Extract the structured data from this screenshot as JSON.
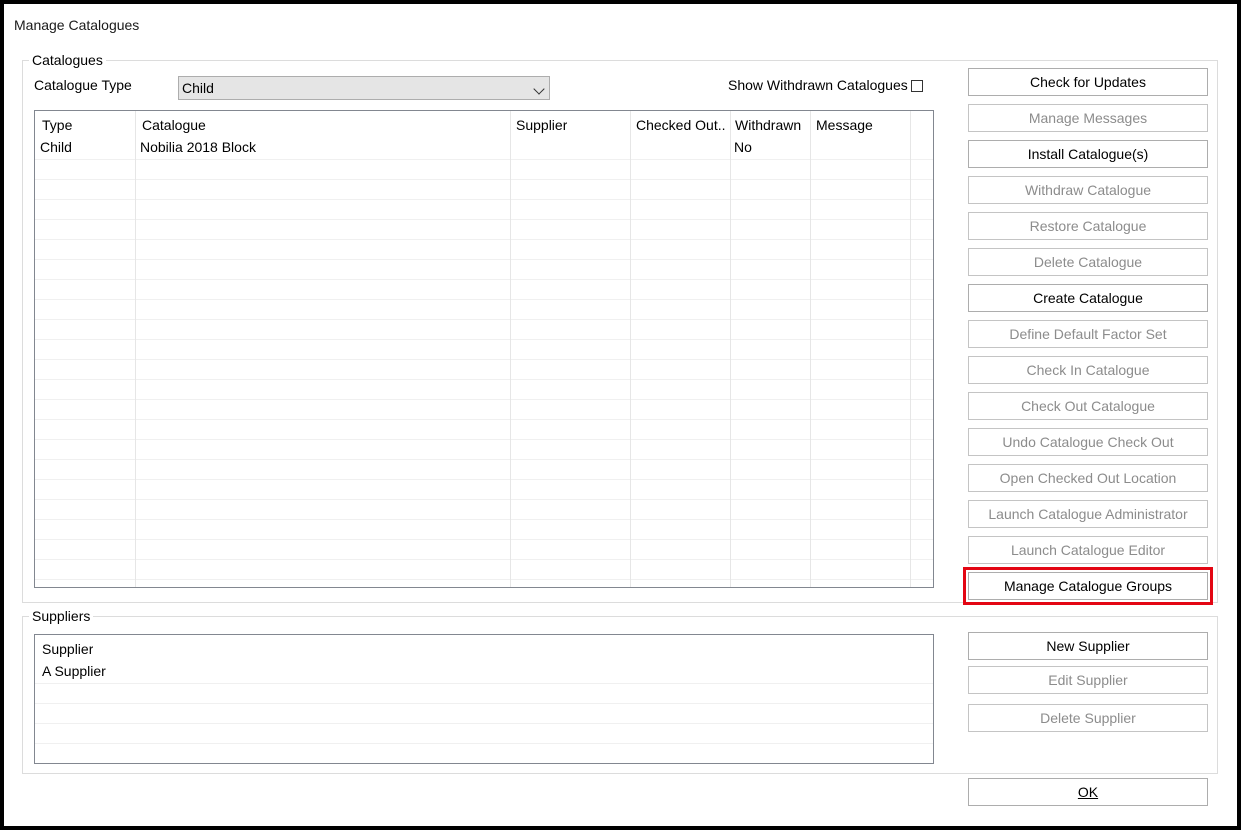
{
  "window": {
    "title": "Manage Catalogues"
  },
  "catalogues_group": {
    "legend": "Catalogues",
    "type_label": "Catalogue Type",
    "type_value": "Child",
    "show_withdrawn_label": "Show Withdrawn Catalogues",
    "show_withdrawn_checked": false,
    "table": {
      "columns": [
        "Type",
        "Catalogue",
        "Supplier",
        "Checked Out...",
        "Withdrawn",
        "Message"
      ],
      "rows": [
        {
          "type": "Child",
          "catalogue": "Nobilia 2018 Block",
          "supplier": "",
          "checked_out": "",
          "withdrawn": "No",
          "message": ""
        }
      ]
    }
  },
  "catalogue_buttons": [
    {
      "label": "Check for Updates",
      "enabled": true,
      "name": "check-for-updates-button"
    },
    {
      "label": "Manage Messages",
      "enabled": false,
      "name": "manage-messages-button"
    },
    {
      "label": "Install Catalogue(s)",
      "enabled": true,
      "name": "install-catalogues-button"
    },
    {
      "label": "Withdraw Catalogue",
      "enabled": false,
      "name": "withdraw-catalogue-button"
    },
    {
      "label": "Restore Catalogue",
      "enabled": false,
      "name": "restore-catalogue-button"
    },
    {
      "label": "Delete Catalogue",
      "enabled": false,
      "name": "delete-catalogue-button"
    },
    {
      "label": "Create Catalogue",
      "enabled": true,
      "name": "create-catalogue-button"
    },
    {
      "label": "Define Default Factor Set",
      "enabled": false,
      "name": "define-default-factor-set-button"
    },
    {
      "label": "Check In Catalogue",
      "enabled": false,
      "name": "check-in-catalogue-button"
    },
    {
      "label": "Check Out Catalogue",
      "enabled": false,
      "name": "check-out-catalogue-button"
    },
    {
      "label": "Undo Catalogue Check Out",
      "enabled": false,
      "name": "undo-catalogue-check-out-button"
    },
    {
      "label": "Open Checked Out Location",
      "enabled": false,
      "name": "open-checked-out-location-button"
    },
    {
      "label": "Launch Catalogue Administrator",
      "enabled": false,
      "name": "launch-catalogue-administrator-button"
    },
    {
      "label": "Launch Catalogue Editor",
      "enabled": false,
      "name": "launch-catalogue-editor-button"
    },
    {
      "label": "Manage Catalogue Groups",
      "enabled": true,
      "name": "manage-catalogue-groups-button",
      "highlighted": true
    }
  ],
  "suppliers_group": {
    "legend": "Suppliers",
    "table": {
      "column": "Supplier",
      "rows": [
        "A Supplier"
      ]
    }
  },
  "supplier_buttons": [
    {
      "label": "New Supplier",
      "enabled": true,
      "name": "new-supplier-button"
    },
    {
      "label": "Edit Supplier",
      "enabled": false,
      "name": "edit-supplier-button"
    },
    {
      "label": "Delete Supplier",
      "enabled": false,
      "name": "delete-supplier-button"
    }
  ],
  "ok_button": {
    "label": "OK"
  },
  "colors": {
    "highlight": "#e30613",
    "disabled_text": "#8c8c8c"
  }
}
